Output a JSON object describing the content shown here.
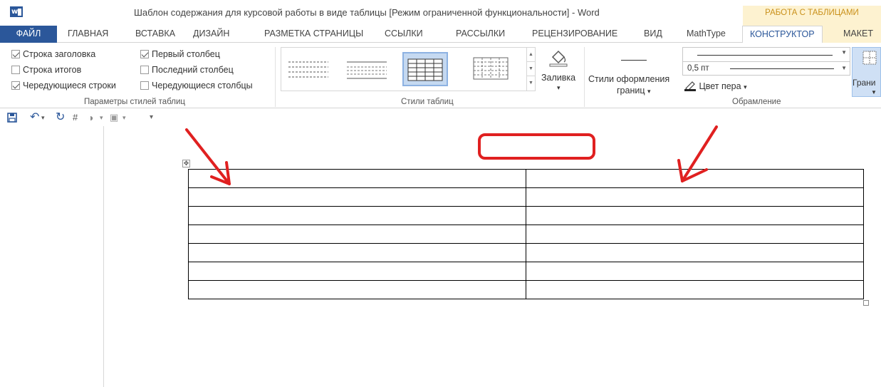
{
  "window": {
    "title": "Шаблон содержания для курсовой работы в виде таблицы [Режим ограниченной функциональности] - Word",
    "contextual_group": "РАБОТА С ТАБЛИЦАМИ",
    "app_icon": "word-icon"
  },
  "tabs": [
    {
      "label": "ФАЙЛ"
    },
    {
      "label": "ГЛАВНАЯ"
    },
    {
      "label": "ВСТАВКА"
    },
    {
      "label": "ДИЗАЙН"
    },
    {
      "label": "РАЗМЕТКА СТРАНИЦЫ"
    },
    {
      "label": "ССЫЛКИ"
    },
    {
      "label": "РАССЫЛКИ"
    },
    {
      "label": "РЕЦЕНЗИРОВАНИЕ"
    },
    {
      "label": "ВИД"
    },
    {
      "label": "MathType"
    },
    {
      "label": "КОНСТРУКТОР"
    },
    {
      "label": "МАКЕТ"
    }
  ],
  "active_tab": "КОНСТРУКТОР",
  "style_options": {
    "group_label": "Параметры стилей таблиц",
    "header_row": {
      "label": "Строка заголовка",
      "checked": true
    },
    "total_row": {
      "label": "Строка итогов",
      "checked": false
    },
    "banded_rows": {
      "label": "Чередующиеся строки",
      "checked": true
    },
    "first_column": {
      "label": "Первый столбец",
      "checked": true
    },
    "last_column": {
      "label": "Последний столбец",
      "checked": false
    },
    "banded_columns": {
      "label": "Чередующиеся столбцы",
      "checked": false
    }
  },
  "table_styles": {
    "group_label": "Стили таблиц",
    "shading_label": "Заливка",
    "shading_arrow": "▾"
  },
  "borders": {
    "group_label": "Обрамление",
    "border_styles_label_1": "Стили оформления",
    "border_styles_label_2": "границ",
    "border_styles_arrow": "▾",
    "pen_weight": "0,5 пт",
    "pen_color": "Цвет пера",
    "pen_color_arrow": "▾",
    "borders_button": "Грани"
  },
  "qat": {
    "save": "save-icon",
    "undo": "undo-icon",
    "redo": "redo-icon"
  },
  "document": {
    "table": {
      "rows": 7,
      "columns": 2,
      "cells": [
        [
          "",
          ""
        ],
        [
          "",
          ""
        ],
        [
          "",
          ""
        ],
        [
          "",
          ""
        ],
        [
          "",
          ""
        ],
        [
          "",
          ""
        ],
        [
          "",
          ""
        ]
      ]
    },
    "move_handle_glyph": "✥"
  },
  "colors": {
    "accent": "#2b579a",
    "contextual": "#fdf2d0",
    "contextual_text": "#c9901a",
    "annotation": "#e02020"
  }
}
